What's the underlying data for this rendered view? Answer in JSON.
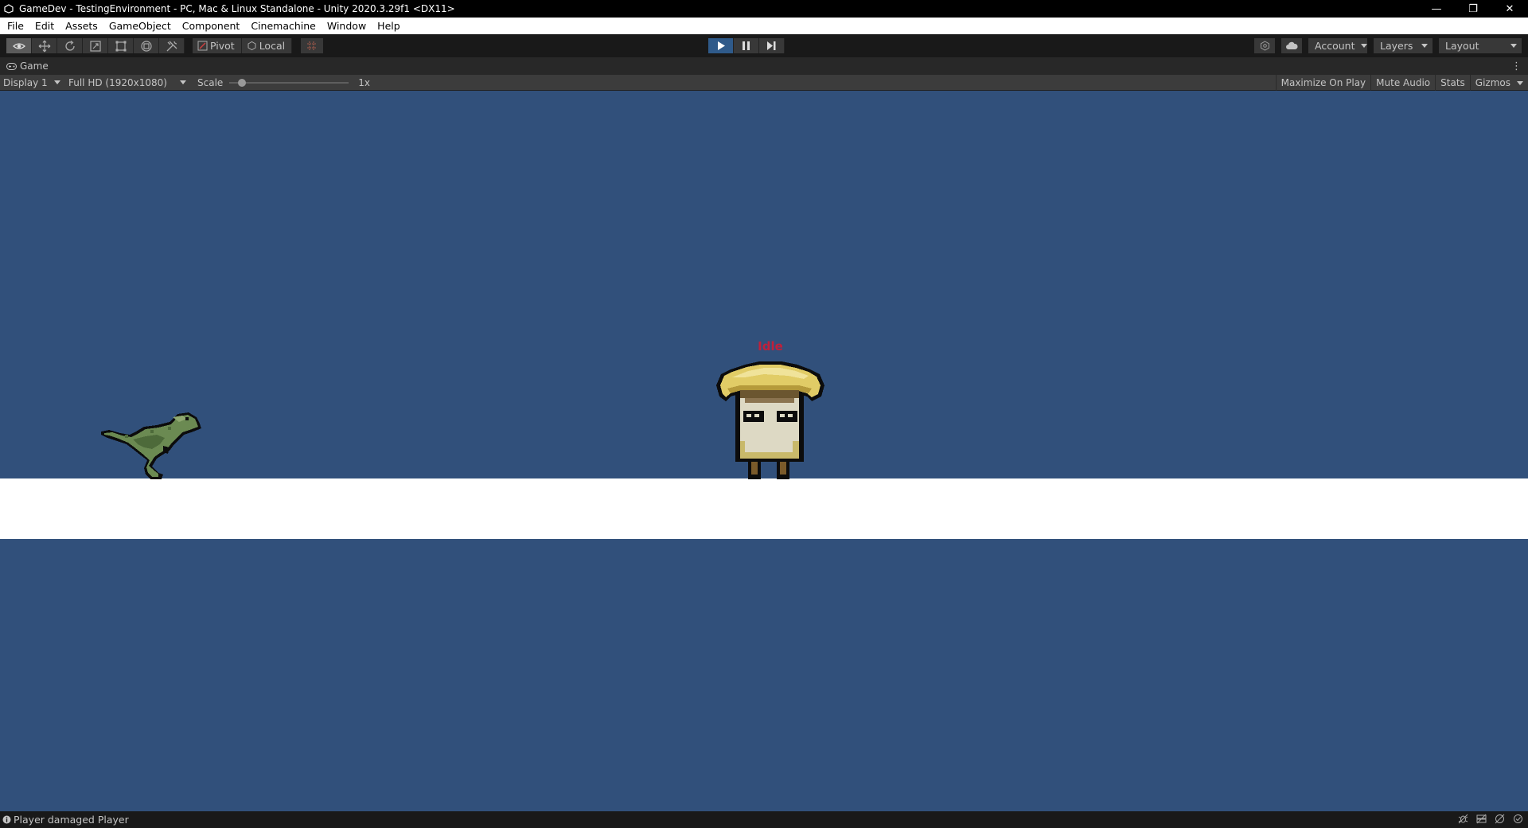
{
  "window": {
    "title": "GameDev - TestingEnvironment - PC, Mac & Linux Standalone - Unity 2020.3.29f1 <DX11>",
    "controls": {
      "minimize": "—",
      "restore": "❐",
      "close": "✕"
    }
  },
  "menu": {
    "items": [
      "File",
      "Edit",
      "Assets",
      "GameObject",
      "Component",
      "Cinemachine",
      "Window",
      "Help"
    ]
  },
  "toolbar": {
    "tools": [
      "view-tool-icon",
      "move-tool-icon",
      "rotate-tool-icon",
      "scale-tool-icon",
      "rect-tool-icon",
      "transform-tool-icon",
      "custom-tool-icon"
    ],
    "pivot_label": "Pivot",
    "local_label": "Local",
    "account_label": "Account",
    "layers_label": "Layers",
    "layout_label": "Layout",
    "play_state": "playing"
  },
  "game_tab": {
    "label": "Game"
  },
  "game_controls": {
    "display": "Display 1",
    "resolution": "Full HD (1920x1080)",
    "scale_label": "Scale",
    "scale_value": "1x",
    "scale_fraction": 0.08,
    "maximize_on_play": "Maximize On Play",
    "mute_audio": "Mute Audio",
    "stats": "Stats",
    "gizmos": "Gizmos"
  },
  "scene": {
    "player_state_label": "Idle",
    "player_state_color": "#c0203a",
    "sky_color": "#31507b",
    "ground_color": "#ffffff"
  },
  "status": {
    "message": "Player damaged Player"
  }
}
